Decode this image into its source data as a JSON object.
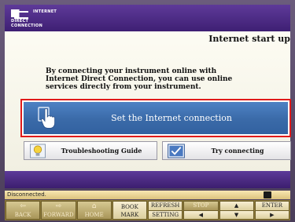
{
  "header": {
    "logo_line1": "INTERNET",
    "logo_line2": "DIRECT CONNECTION"
  },
  "page": {
    "title": "Internet start up",
    "intro": "By connecting your instrument online with Internet Direct Connection, you can use online services directly from your instrument."
  },
  "buttons": {
    "set_connection": "Set the Internet connection",
    "troubleshooting": "Troubleshooting Guide",
    "try_connecting": "Try connecting"
  },
  "status": {
    "text": "Disconnected."
  },
  "toolbar": {
    "back": "BACK",
    "forward": "FORWARD",
    "home": "HOME",
    "bookmark_top": "BOOK",
    "bookmark_bottom": "MARK",
    "refresh": "REFRESH",
    "setting": "SETTING",
    "stop": "STOP",
    "up": "▲",
    "down": "▼",
    "enter": "ENTER",
    "left": "◀",
    "right": "▶"
  },
  "colors": {
    "header": "#4a2a85",
    "primary_button": "#3a6aa8",
    "highlight_border": "#e01a1a",
    "status_bar": "#ecd596"
  }
}
